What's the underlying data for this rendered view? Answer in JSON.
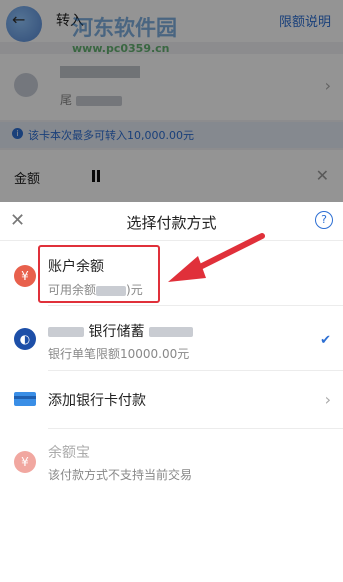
{
  "header": {
    "back_icon": "back-arrow-icon",
    "title": "转入",
    "limit_link": "限额说明"
  },
  "watermark": {
    "text": "河东软件园",
    "url": "www.pc0359.cn"
  },
  "card": {
    "tail_prefix": "尾"
  },
  "info": {
    "text": "该卡本次最多可转入10,000.00元"
  },
  "amount": {
    "label": "金额"
  },
  "sheet": {
    "title": "选择付款方式",
    "close_icon": "close-icon",
    "help_icon": "help-icon",
    "options": [
      {
        "title": "账户余额",
        "subtitle_prefix": "可用余额",
        "subtitle_suffix": ")元",
        "icon": "yuan-icon",
        "color": "#e8604c"
      },
      {
        "title_suffix": "银行储蓄",
        "subtitle": "银行单笔限额10000.00元",
        "icon": "bank-logo-icon",
        "color": "#1d4fa8",
        "selected": true
      },
      {
        "title": "添加银行卡付款",
        "icon": "card-icon",
        "color": "#3a8ee6"
      },
      {
        "title": "余额宝",
        "subtitle": "该付款方式不支持当前交易",
        "icon": "yuebao-icon",
        "color": "#f1a7a0",
        "disabled": true
      }
    ]
  },
  "accent": "#2d6fd3",
  "annotation_color": "#e0303a"
}
